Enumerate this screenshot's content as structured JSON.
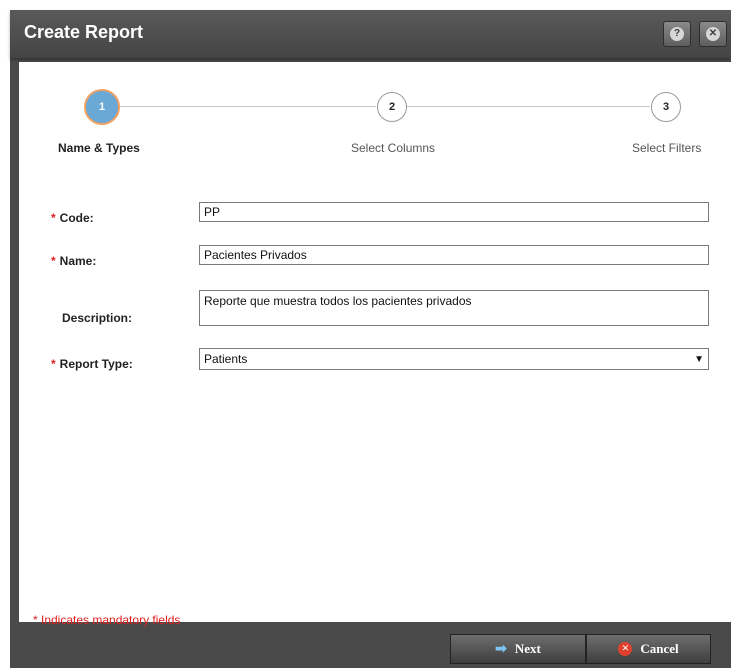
{
  "dialog": {
    "title": "Create Report",
    "help_icon": "help-icon",
    "close_icon": "close-icon"
  },
  "wizard": {
    "steps": [
      {
        "number": "1",
        "label": "Name & Types",
        "active": true
      },
      {
        "number": "2",
        "label": "Select Columns",
        "active": false
      },
      {
        "number": "3",
        "label": "Select Filters",
        "active": false
      }
    ]
  },
  "form": {
    "code": {
      "required_mark": "*",
      "label": "Code:",
      "value": "PP"
    },
    "name": {
      "required_mark": "*",
      "label": "Name:",
      "value": "Pacientes Privados"
    },
    "description": {
      "label": "Description:",
      "value": "Reporte que muestra todos los pacientes privados"
    },
    "report_type": {
      "required_mark": "*",
      "label": "Report Type:",
      "value": "Patients"
    }
  },
  "mandatory_note": "* Indicates mandatory fields",
  "footer": {
    "next_label": "Next",
    "cancel_label": "Cancel"
  },
  "colors": {
    "titlebar": "#4a4a4a",
    "active_step": "#6aa8d6",
    "active_step_ring": "#f0a060",
    "required": "#e02020"
  }
}
